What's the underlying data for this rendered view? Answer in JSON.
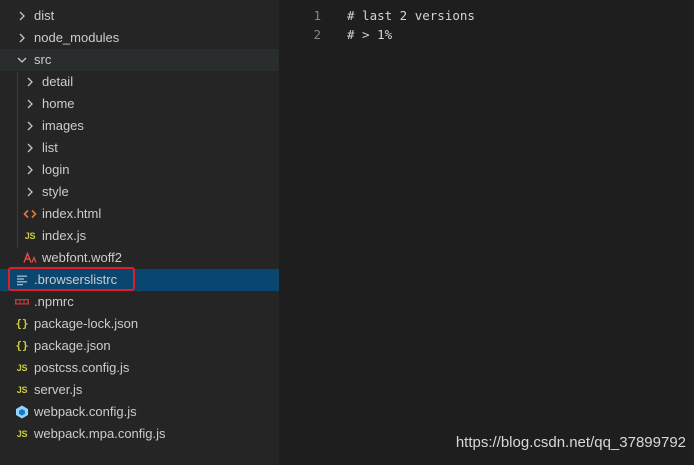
{
  "explorer": {
    "items": [
      {
        "label": "dist",
        "icon": "chevron-right-icon"
      },
      {
        "label": "node_modules",
        "icon": "chevron-right-icon"
      },
      {
        "label": "src",
        "icon": "chevron-down-icon"
      },
      {
        "label": "detail",
        "icon": "chevron-right-icon"
      },
      {
        "label": "home",
        "icon": "chevron-right-icon"
      },
      {
        "label": "images",
        "icon": "chevron-right-icon"
      },
      {
        "label": "list",
        "icon": "chevron-right-icon"
      },
      {
        "label": "login",
        "icon": "chevron-right-icon"
      },
      {
        "label": "style",
        "icon": "chevron-right-icon"
      },
      {
        "label": "index.html",
        "icon": "html-icon"
      },
      {
        "label": "index.js",
        "icon": "js-icon",
        "badge": "JS"
      },
      {
        "label": "webfont.woff2",
        "icon": "font-icon"
      },
      {
        "label": ".browserslistrc",
        "icon": "lines-icon"
      },
      {
        "label": ".npmrc",
        "icon": "npm-icon"
      },
      {
        "label": "package-lock.json",
        "icon": "json-icon",
        "badge": "{}"
      },
      {
        "label": "package.json",
        "icon": "json-icon",
        "badge": "{}"
      },
      {
        "label": "postcss.config.js",
        "icon": "js-icon",
        "badge": "JS"
      },
      {
        "label": "server.js",
        "icon": "js-icon",
        "badge": "JS"
      },
      {
        "label": "webpack.config.js",
        "icon": "webpack-icon"
      },
      {
        "label": "webpack.mpa.config.js",
        "icon": "js-icon",
        "badge": "JS"
      }
    ],
    "selected": ".browserslistrc"
  },
  "editor": {
    "lines": [
      {
        "number": "1",
        "text": "# last 2 versions"
      },
      {
        "number": "2",
        "text": "# > 1%"
      }
    ]
  },
  "watermark": "https://blog.csdn.net/qq_37899792",
  "colors": {
    "sidebar_bg": "#252526",
    "editor_bg": "#1e1e1e",
    "selection_bg": "#094771",
    "highlight_border": "#e51c23",
    "js_yellow": "#cbcb41",
    "html_orange": "#e37933",
    "webpack_blue": "#8ed6fb"
  }
}
